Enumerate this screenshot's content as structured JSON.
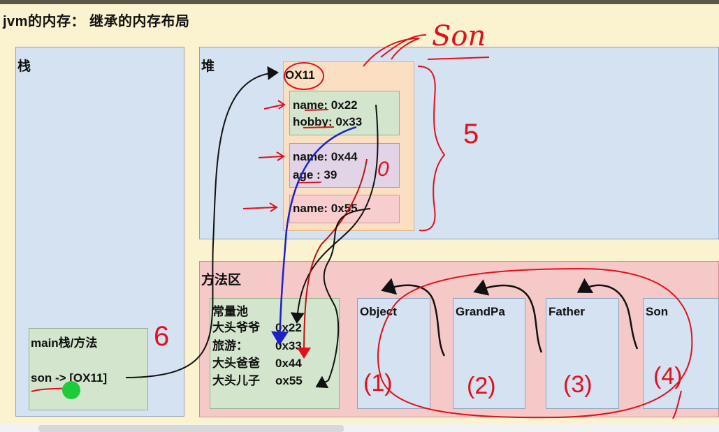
{
  "title": "jvm的内存： 继承的内存布局",
  "stack": {
    "label": "栈",
    "frame_label": "main栈/方法",
    "frame_var": "son -> [OX11]"
  },
  "heap": {
    "label": "堆",
    "object_address": "OX11",
    "son_fields_1": [
      "name: 0x22",
      "hobby: 0x33"
    ],
    "father_fields": [
      "name: 0x44",
      "age :   39"
    ],
    "grandpa_fields": [
      "name: 0x55"
    ]
  },
  "method_area": {
    "label": "方法区",
    "pool_title": "常量池",
    "pool_entries": [
      {
        "name": "大头爷爷",
        "addr": "0x22"
      },
      {
        "name": "旅游：",
        "addr": "0x33"
      },
      {
        "name": "大头爸爸",
        "addr": "0x44"
      },
      {
        "name": "大头儿子",
        "addr": "ox55"
      }
    ],
    "classes": [
      "Object",
      "GrandPa",
      "Father",
      "Son"
    ]
  },
  "annotations": {
    "son_note": "Son",
    "five": "5",
    "six": "6",
    "zero": "0",
    "class_numbers": [
      "(1)",
      "(2)",
      "(3)",
      "(4)"
    ]
  },
  "colors": {
    "background": "#fbf2cf",
    "panel_blue": "#d5e2f1",
    "object_orange": "#fbdfc3",
    "green_box": "#d3e5cc",
    "purple_box": "#e0d4e6",
    "pink_box": "#f7cdcd",
    "method_area": "#f6c9c9",
    "pen_red": "#e0101c",
    "pen_blue": "#1a22c8",
    "pen_black": "#111111",
    "dot_green": "#1ecc3a"
  }
}
